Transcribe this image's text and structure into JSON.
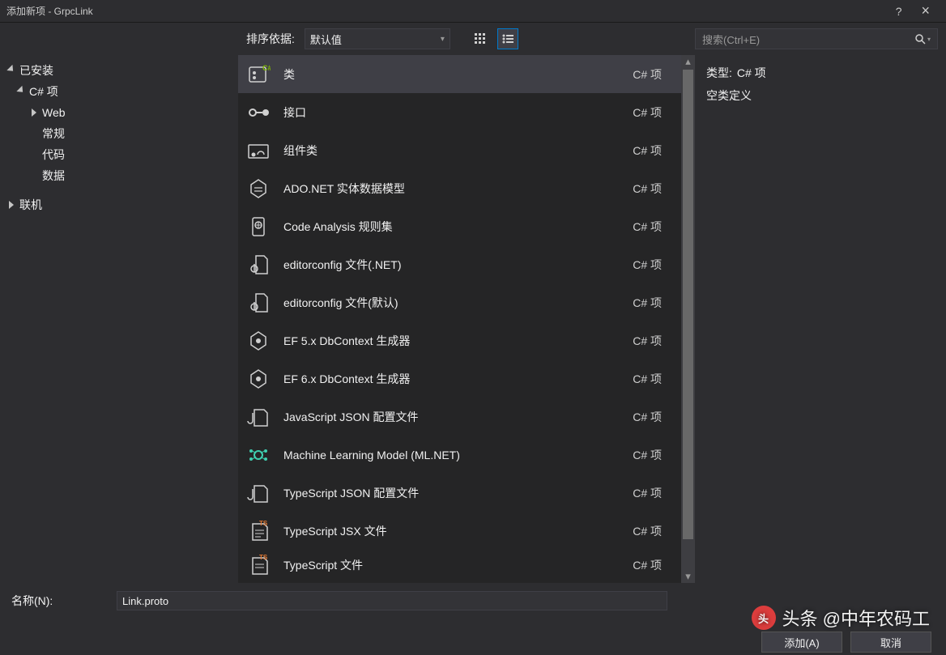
{
  "window": {
    "title": "添加新项 - GrpcLink",
    "help": "?",
    "close": "×"
  },
  "tree": {
    "installed": "已安装",
    "csharp": "C# 项",
    "web": "Web",
    "general": "常规",
    "code": "代码",
    "data": "数据",
    "online": "联机"
  },
  "sort": {
    "label": "排序依据:",
    "value": "默认值"
  },
  "search": {
    "placeholder": "搜索(Ctrl+E)"
  },
  "tag": "C# 项",
  "items": [
    {
      "name": "类"
    },
    {
      "name": "接口"
    },
    {
      "name": "组件类"
    },
    {
      "name": "ADO.NET 实体数据模型"
    },
    {
      "name": "Code Analysis 规则集"
    },
    {
      "name": "editorconfig 文件(.NET)"
    },
    {
      "name": "editorconfig 文件(默认)"
    },
    {
      "name": "EF 5.x DbContext 生成器"
    },
    {
      "name": "EF 6.x DbContext 生成器"
    },
    {
      "name": "JavaScript JSON 配置文件"
    },
    {
      "name": "Machine Learning Model (ML.NET)"
    },
    {
      "name": "TypeScript JSON 配置文件"
    },
    {
      "name": "TypeScript JSX 文件"
    },
    {
      "name": "TypeScript 文件"
    }
  ],
  "detail": {
    "type_label": "类型:",
    "type_value": "C# 项",
    "desc": "空类定义"
  },
  "footer": {
    "name_label": "名称(N):",
    "name_value": "Link.proto",
    "add": "添加(A)",
    "cancel": "取消"
  },
  "watermark": "头条 @中年农码工"
}
